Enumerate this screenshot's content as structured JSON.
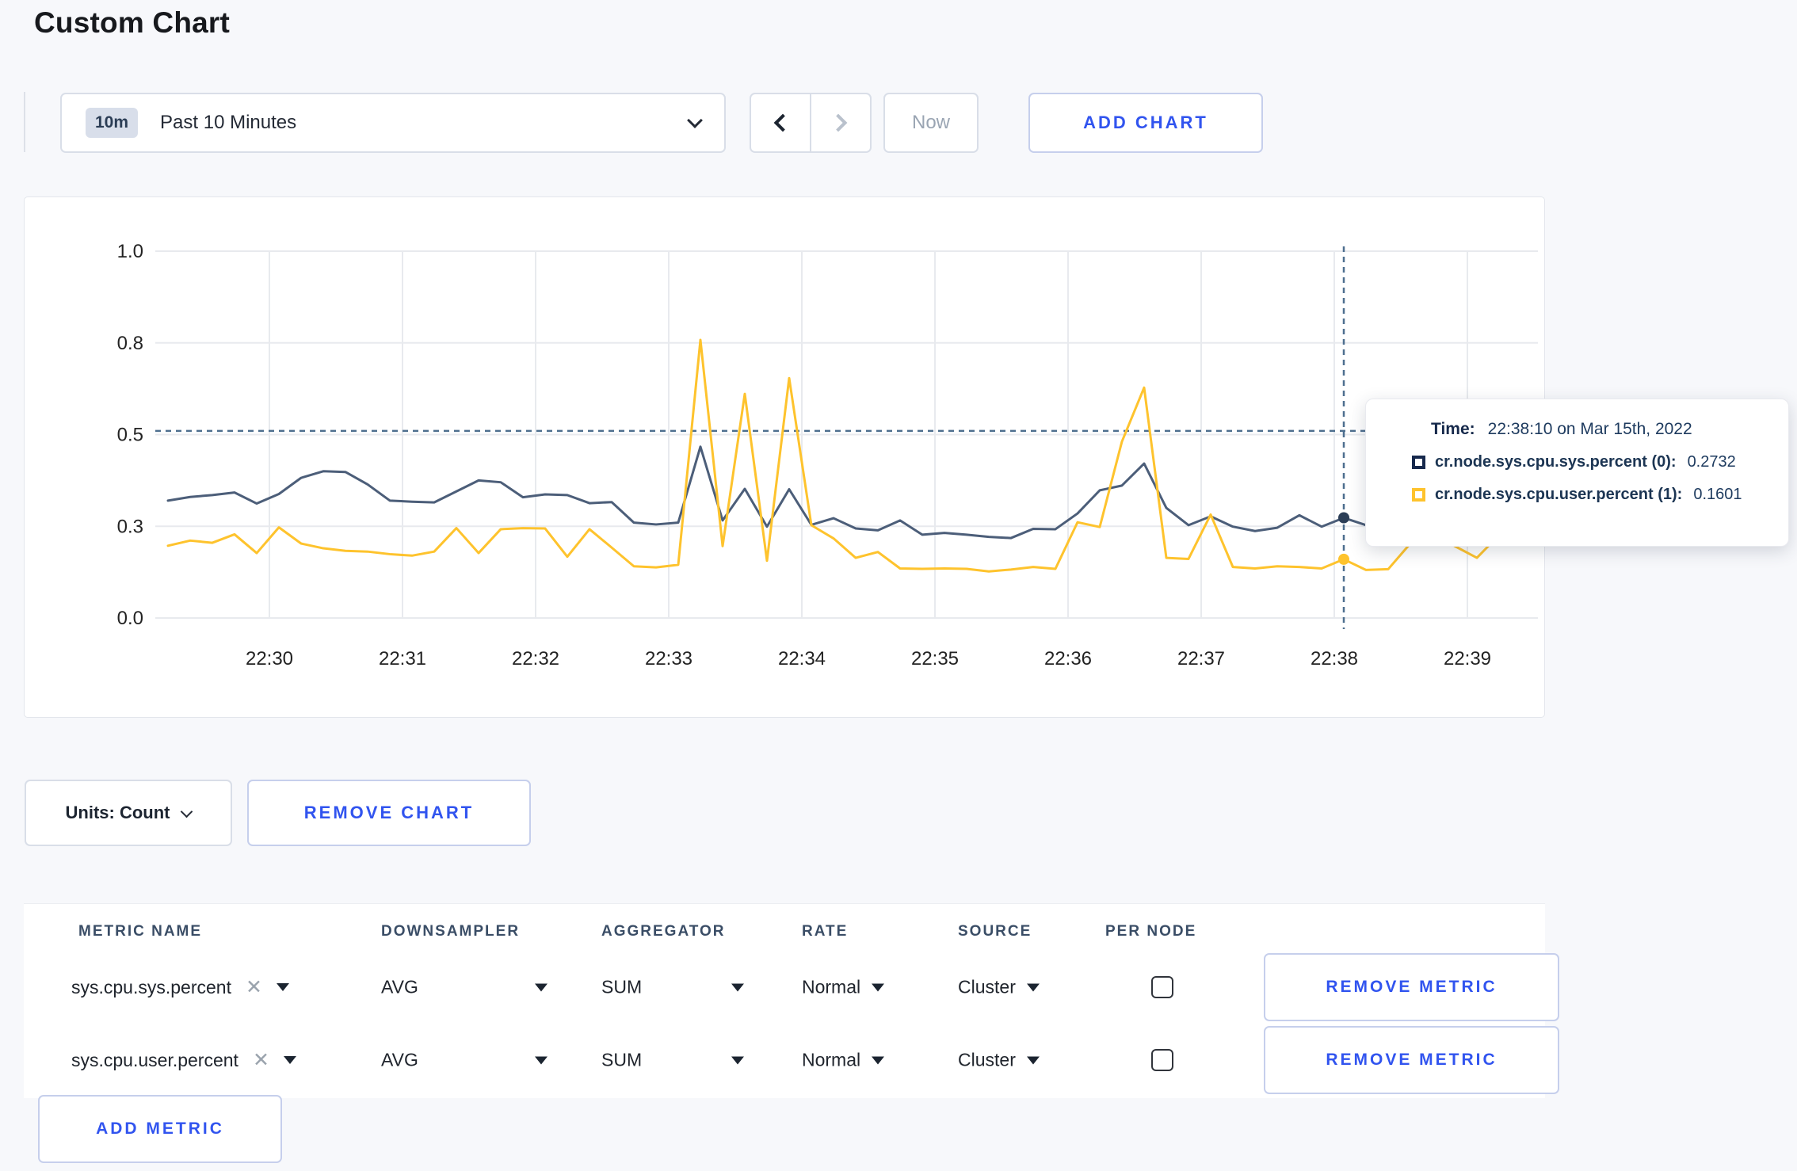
{
  "page": {
    "title": "Custom Chart"
  },
  "toolbar": {
    "range_badge": "10m",
    "range_label": "Past 10 Minutes",
    "back_icon": "chevron-left",
    "forward_icon": "chevron-right",
    "now_label": "Now",
    "add_chart_label": "ADD CHART"
  },
  "chart_data": {
    "type": "line",
    "title": "",
    "xlabel": "",
    "ylabel": "",
    "ylim": [
      0,
      1
    ],
    "grid": true,
    "x_tick_labels": [
      "22:30",
      "22:31",
      "22:32",
      "22:33",
      "22:34",
      "22:35",
      "22:36",
      "22:37",
      "22:38",
      "22:39"
    ],
    "y_ticks": {
      "values": [
        0,
        0.25,
        0.5,
        0.75,
        1.0
      ],
      "labels": [
        "0.0",
        "0.3",
        "0.5",
        "0.8",
        "1.0"
      ]
    },
    "x_start": "22:29:20",
    "x_step_seconds": 10,
    "series": [
      {
        "name": "cr.node.sys.cpu.sys.percent",
        "color": "#4c5e79",
        "values": [
          0.32,
          0.33,
          0.335,
          0.342,
          0.312,
          0.338,
          0.382,
          0.4,
          0.398,
          0.364,
          0.32,
          0.317,
          0.315,
          0.345,
          0.375,
          0.37,
          0.329,
          0.337,
          0.335,
          0.313,
          0.316,
          0.26,
          0.255,
          0.26,
          0.467,
          0.266,
          0.352,
          0.249,
          0.351,
          0.254,
          0.272,
          0.244,
          0.239,
          0.266,
          0.227,
          0.232,
          0.227,
          0.221,
          0.218,
          0.243,
          0.242,
          0.285,
          0.348,
          0.361,
          0.421,
          0.3,
          0.253,
          0.277,
          0.249,
          0.237,
          0.246,
          0.28,
          0.249,
          0.273,
          0.253,
          0.262,
          0.27,
          0.29,
          0.3,
          0.298,
          0.302
        ]
      },
      {
        "name": "cr.node.sys.cpu.user.percent",
        "color": "#fec32d",
        "values": [
          0.197,
          0.211,
          0.205,
          0.228,
          0.177,
          0.247,
          0.203,
          0.19,
          0.183,
          0.181,
          0.174,
          0.17,
          0.181,
          0.245,
          0.177,
          0.242,
          0.245,
          0.244,
          0.167,
          0.242,
          0.192,
          0.141,
          0.138,
          0.145,
          0.758,
          0.196,
          0.611,
          0.156,
          0.654,
          0.253,
          0.217,
          0.164,
          0.18,
          0.135,
          0.134,
          0.135,
          0.134,
          0.127,
          0.132,
          0.139,
          0.134,
          0.261,
          0.248,
          0.481,
          0.628,
          0.164,
          0.161,
          0.282,
          0.139,
          0.135,
          0.141,
          0.139,
          0.135,
          0.16,
          0.131,
          0.133,
          0.203,
          0.24,
          0.196,
          0.164,
          0.226
        ]
      }
    ],
    "crosshair": {
      "index": 53,
      "time": "22:38:10",
      "hline_value": 0.51,
      "point_values": [
        0.2732,
        0.1601
      ]
    },
    "legend_position": "tooltip"
  },
  "tooltip": {
    "time_label": "Time:",
    "time_value": "22:38:10 on Mar 15th, 2022",
    "rows": [
      {
        "label": "cr.node.sys.cpu.sys.percent (0):",
        "value": "0.2732",
        "color": "#17294d"
      },
      {
        "label": "cr.node.sys.cpu.user.percent (1):",
        "value": "0.1601",
        "color": "#fec32d"
      }
    ]
  },
  "chart_actions": {
    "units_label": "Units: Count",
    "remove_chart_label": "REMOVE CHART"
  },
  "metrics_table": {
    "headers": [
      "METRIC NAME",
      "DOWNSAMPLER",
      "AGGREGATOR",
      "RATE",
      "SOURCE",
      "PER NODE"
    ],
    "rows": [
      {
        "name": "sys.cpu.sys.percent",
        "downsampler": "AVG",
        "aggregator": "SUM",
        "rate": "Normal",
        "source": "Cluster",
        "per_node_checked": false,
        "remove_label": "REMOVE METRIC"
      },
      {
        "name": "sys.cpu.user.percent",
        "downsampler": "AVG",
        "aggregator": "SUM",
        "rate": "Normal",
        "source": "Cluster",
        "per_node_checked": false,
        "remove_label": "REMOVE METRIC"
      }
    ],
    "add_metric_label": "ADD METRIC"
  },
  "colors": {
    "accent_blue": "#3154ef",
    "series_sys": "#4c5e79",
    "series_user": "#fec32d",
    "grid": "#e8eaee",
    "crosshair": "#4e6f8f",
    "muted_text": "#9aa5b3",
    "page_bg": "#f7f8fb"
  }
}
